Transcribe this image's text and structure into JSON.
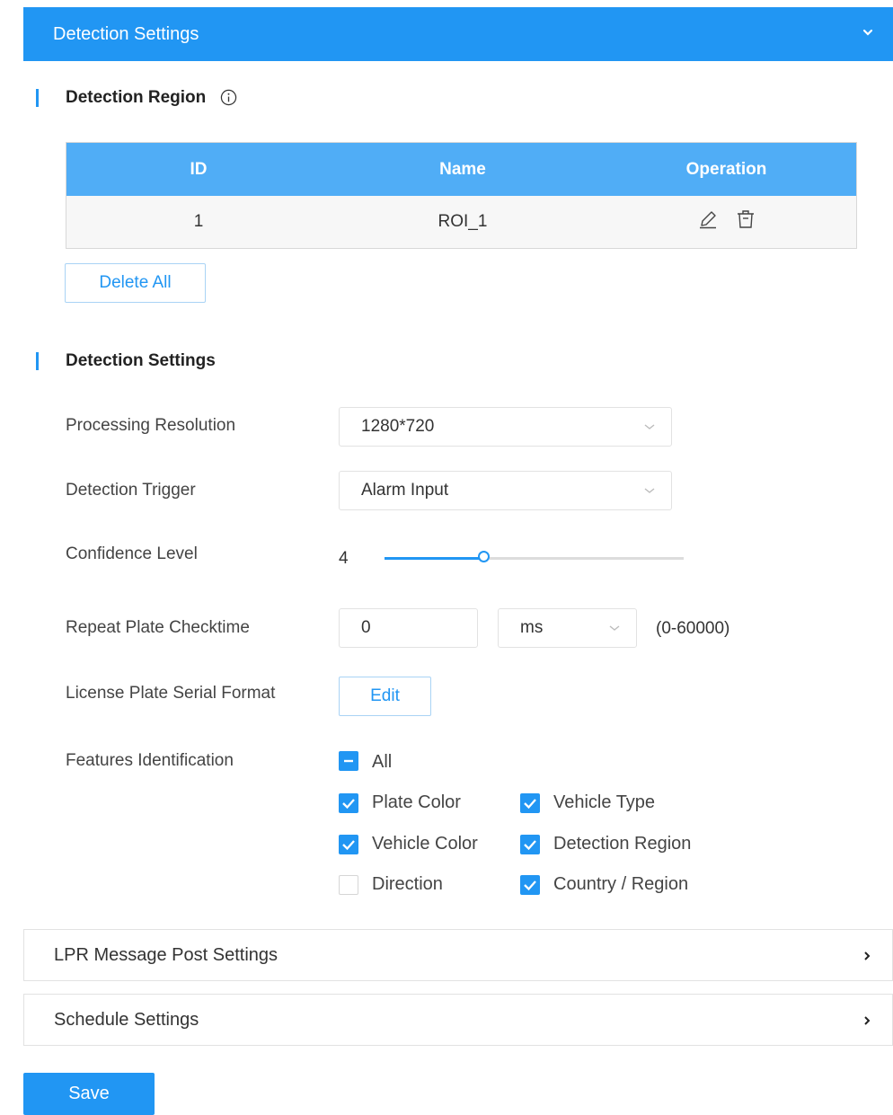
{
  "header": {
    "title": "Detection Settings"
  },
  "region": {
    "title": "Detection Region",
    "table": {
      "columns": [
        "ID",
        "Name",
        "Operation"
      ],
      "rows": [
        {
          "id": "1",
          "name": "ROI_1"
        }
      ]
    },
    "delete_all": "Delete All"
  },
  "settings": {
    "title": "Detection Settings",
    "processing_resolution": {
      "label": "Processing Resolution",
      "value": "1280*720"
    },
    "detection_trigger": {
      "label": "Detection Trigger",
      "value": "Alarm Input"
    },
    "confidence_level": {
      "label": "Confidence Level",
      "value": "4",
      "fraction": 0.33
    },
    "repeat_plate": {
      "label": "Repeat Plate Checktime",
      "value": "0",
      "unit": "ms",
      "range": "(0-60000)"
    },
    "serial_format": {
      "label": "License Plate Serial Format",
      "button": "Edit"
    },
    "features": {
      "label": "Features Identification",
      "all": "All",
      "items": [
        {
          "label": "Plate Color",
          "checked": true
        },
        {
          "label": "Vehicle Type",
          "checked": true
        },
        {
          "label": "Vehicle Color",
          "checked": true
        },
        {
          "label": "Detection Region",
          "checked": true
        },
        {
          "label": "Direction",
          "checked": false
        },
        {
          "label": "Country / Region",
          "checked": true
        }
      ]
    }
  },
  "panels": {
    "lpr": "LPR Message Post Settings",
    "schedule": "Schedule Settings"
  },
  "save": "Save",
  "colors": {
    "accent": "#2196f3",
    "header_bg": "#50adf6"
  }
}
